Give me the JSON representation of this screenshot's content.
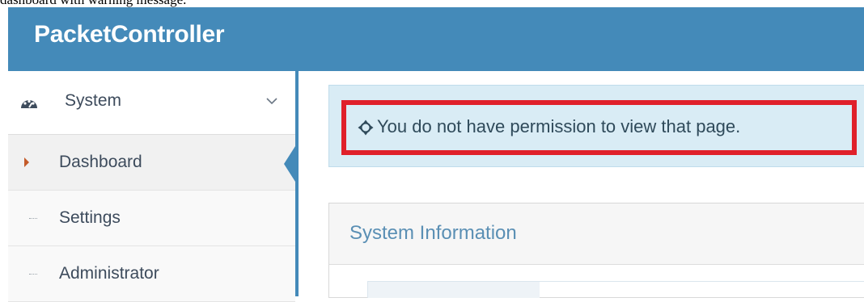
{
  "caption": "dashboard with warning message.",
  "app": {
    "brand": "PacketController"
  },
  "sidebar": {
    "section": {
      "label": "System",
      "icon": "dashboard-gauge-icon",
      "expanded_icon": "chevron-down-icon"
    },
    "items": [
      {
        "label": "Dashboard",
        "active": true
      },
      {
        "label": "Settings",
        "active": false
      },
      {
        "label": "Administrator",
        "active": false
      }
    ]
  },
  "alert": {
    "icon": "crosshair-icon",
    "message": "You do not have permission to view that page.",
    "highlight_color": "#e0202a"
  },
  "panel": {
    "title": "System Information"
  },
  "colors": {
    "brand_bar": "#448ab9",
    "alert_bg": "#d9ecf5",
    "active_caret": "#c45b2a"
  }
}
